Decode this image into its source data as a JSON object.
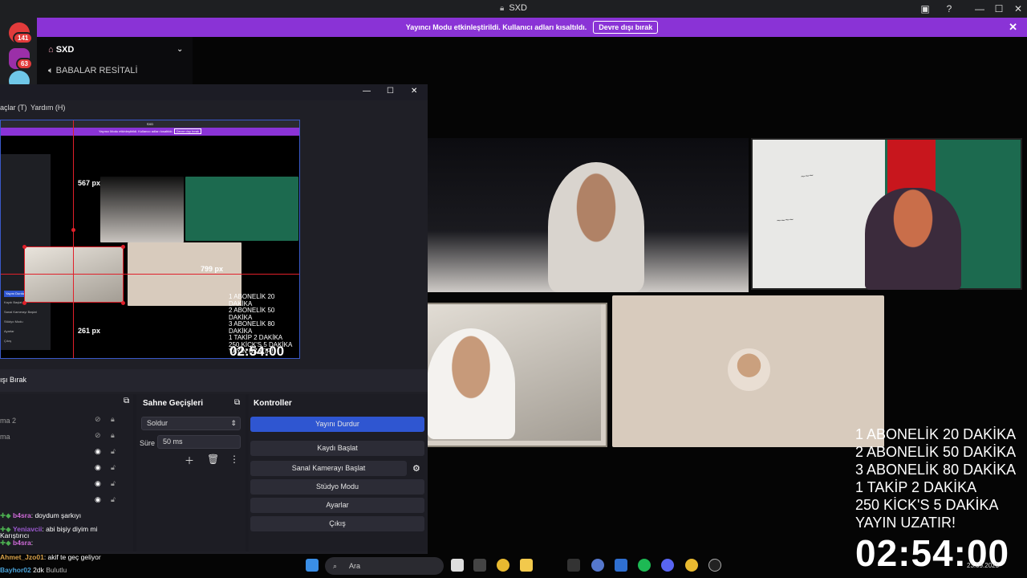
{
  "window": {
    "title": "SXD",
    "icons": [
      "lock-icon",
      "inbox-icon",
      "help-icon",
      "minimize-icon",
      "maximize-icon",
      "close-icon"
    ]
  },
  "banner": {
    "text": "Yayıncı Modu etkinleştirildi. Kullanıcı adları kısaltıldı.",
    "button": "Devre dışı bırak",
    "close": "✕"
  },
  "guilds": {
    "badges": [
      "141",
      "63"
    ]
  },
  "server": {
    "name": "SXD",
    "channel": "BABALAR RESİTALİ"
  },
  "obs": {
    "menu": [
      "Araçlar (T)",
      "Yardım (H)"
    ],
    "menu_visible": [
      "açlar (T)",
      "Yardım (H)"
    ],
    "window_controls": [
      "—",
      "☐",
      "✕"
    ],
    "preview": {
      "inner_title": "SXD",
      "inner_banner": "Yayıncı Modu etkinleştirildi. Kullanıcı adları kısaltıldı.",
      "inner_button": "Devre dışı bırak",
      "px_top": "567 px",
      "px_right": "799 px",
      "px_bottom": "261 px",
      "overlay_lines": [
        "1 ABONELİK 20 DAKİKA",
        "2 ABONELİK 50 DAKİKA",
        "3 ABONELİK 80 DAKİKA",
        "1 TAKİP 2 DAKİKA",
        "250 KİCK'S 5 DAKİKA",
        "YAYIN UZATIR!"
      ],
      "timer": "02:54:00",
      "inner_sidebar": [
        "Yayını Durdur",
        "Kaydı Başlat",
        "Sanal Kamerayı Başlat",
        "Stüdyo Modu",
        "Ayarlar",
        "Çıkış"
      ]
    },
    "disable_label": "ışı Bırak",
    "sources": {
      "rows": [
        "ma 2",
        "ma",
        "",
        "",
        "",
        ""
      ]
    },
    "transitions": {
      "header": "Sahne Geçişleri",
      "selected": "Soldur",
      "duration_label": "Süre",
      "duration_value": "50 ms"
    },
    "controls": {
      "header": "Kontroller",
      "buttons": [
        "Yayını Durdur",
        "Kaydı Başlat",
        "Sanal Kamerayı Başlat",
        "Stüdyo Modu",
        "Ayarlar",
        "Çıkış"
      ]
    }
  },
  "overlay": {
    "lines": [
      "1 ABONELİK 20 DAKİKA",
      "2 ABONELİK 50 DAKİKA",
      "3 ABONELİK 80 DAKİKA",
      "1 TAKİP 2 DAKİKA",
      "250 KİCK'S 5 DAKİKA",
      "YAYIN UZATIR!"
    ],
    "timer": "02:54:00"
  },
  "chat": [
    {
      "user": "b4sra",
      "text": ": doydum şarkıyı",
      "color": "#d06bd9"
    },
    {
      "user": "Yeniavcii",
      "text": ": abi bişiy diyim mi",
      "color": "#9b59d0"
    },
    {
      "user": "",
      "text": "Karıştırıcı",
      "color": "#ddd"
    },
    {
      "user": "b4sra",
      "text": ":",
      "color": "#d06bd9"
    },
    {
      "user": "Ahmet_Jzo01",
      "text": ": akif te geç geliyor",
      "color": "#d9a24a"
    },
    {
      "user": "Bayhor02",
      "text": "2dk",
      "color": "#4aa3d9"
    },
    {
      "user": "",
      "text": "Bulutlu",
      "color": "#ddd"
    }
  ],
  "taskbar": {
    "search_placeholder": "Ara",
    "date": "23.09.2025"
  }
}
